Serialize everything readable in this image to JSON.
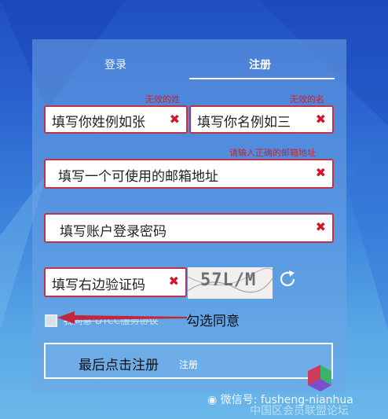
{
  "tabs": {
    "login": "登录",
    "register": "注册"
  },
  "errors": {
    "surname": "无效的姓",
    "given_name": "无效的名",
    "email": "请输入正确的邮箱地址"
  },
  "fields": {
    "surname": "填写你姓例如张",
    "given_name": "填写你名例如三",
    "email": "填写一个可使用的邮箱地址",
    "password": "填写账户登录密码",
    "captcha_input": "填写右边验证码"
  },
  "captcha": {
    "code": "57L/M"
  },
  "clear_icon": "✖",
  "agreement": {
    "text": "我同意 DTCC服务协议"
  },
  "annotation": {
    "check": "勾选同意"
  },
  "submit": {
    "label": "最后点击注册",
    "small": "注册"
  },
  "watermark": {
    "line1": "微信号: fusheng-nianhua",
    "line2": "中国区会员联盟论坛"
  },
  "colors": {
    "error": "#d21f2a",
    "field_border": "#c2324a",
    "panel": "#6ea5e6"
  },
  "icons": [
    "close-icon",
    "refresh-icon",
    "arrow-left-icon",
    "wechat-icon"
  ]
}
